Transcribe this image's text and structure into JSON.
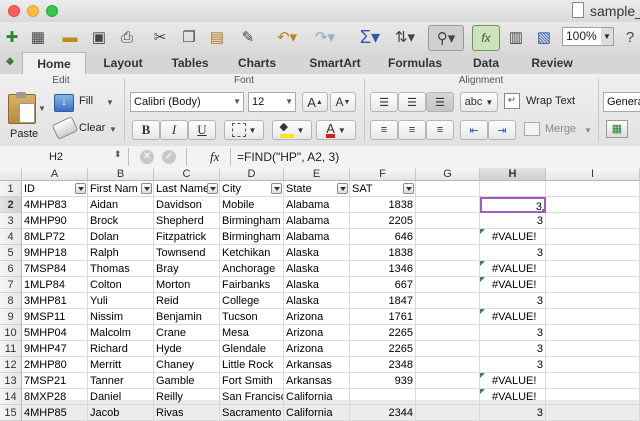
{
  "window": {
    "title": "sample_"
  },
  "toolbar": {
    "zoom": "100%"
  },
  "tabs": [
    "Home",
    "Layout",
    "Tables",
    "Charts",
    "SmartArt",
    "Formulas",
    "Data",
    "Review"
  ],
  "ribbon": {
    "edit_label": "Edit",
    "font_label": "Font",
    "alignment_label": "Alignment",
    "paste_label": "Paste",
    "fill_label": "Fill",
    "clear_label": "Clear",
    "font_name": "Calibri (Body)",
    "font_size": "12",
    "bold": "B",
    "italic": "I",
    "underline": "U",
    "abc_label": "abc",
    "wrap_text_label": "Wrap Text",
    "merge_label": "Merge",
    "number_format": "Genera"
  },
  "formula_bar": {
    "cell_ref": "H2",
    "fx": "fx",
    "formula": "=FIND(\"HP\", A2, 3)"
  },
  "columns": [
    "A",
    "B",
    "C",
    "D",
    "E",
    "F",
    "G",
    "H",
    "I"
  ],
  "header_row": [
    "ID",
    "First Nam",
    "Last Name",
    "City",
    "State",
    "SAT",
    "",
    "",
    ""
  ],
  "rows": [
    [
      "4MHP83",
      "Aidan",
      "Davidson",
      "Mobile",
      "Alabama",
      "1838",
      "",
      "3",
      ""
    ],
    [
      "4MHP90",
      "Brock",
      "Shepherd",
      "Birmingham",
      "Alabama",
      "2205",
      "",
      "3",
      ""
    ],
    [
      "8MLP72",
      "Dolan",
      "Fitzpatrick",
      "Birmingham",
      "Alabama",
      "646",
      "",
      "#VALUE!",
      ""
    ],
    [
      "9MHP18",
      "Ralph",
      "Townsend",
      "Ketchikan",
      "Alaska",
      "1838",
      "",
      "3",
      ""
    ],
    [
      "7MSP84",
      "Thomas",
      "Bray",
      "Anchorage",
      "Alaska",
      "1346",
      "",
      "#VALUE!",
      ""
    ],
    [
      "1MLP84",
      "Colton",
      "Morton",
      "Fairbanks",
      "Alaska",
      "667",
      "",
      "#VALUE!",
      ""
    ],
    [
      "3MHP81",
      "Yuli",
      "Reid",
      "College",
      "Alaska",
      "1847",
      "",
      "3",
      ""
    ],
    [
      "9MSP11",
      "Nissim",
      "Benjamin",
      "Tucson",
      "Arizona",
      "1761",
      "",
      "#VALUE!",
      ""
    ],
    [
      "5MHP04",
      "Malcolm",
      "Crane",
      "Mesa",
      "Arizona",
      "2265",
      "",
      "3",
      ""
    ],
    [
      "9MHP47",
      "Richard",
      "Hyde",
      "Glendale",
      "Arizona",
      "2265",
      "",
      "3",
      ""
    ],
    [
      "2MHP80",
      "Merritt",
      "Chaney",
      "Little Rock",
      "Arkansas",
      "2348",
      "",
      "3",
      ""
    ],
    [
      "7MSP21",
      "Tanner",
      "Gamble",
      "Fort Smith",
      "Arkansas",
      "939",
      "",
      "#VALUE!",
      ""
    ],
    [
      "8MXP28",
      "Daniel",
      "Reilly",
      "San Francisco",
      "California",
      "",
      "",
      "#VALUE!",
      ""
    ],
    [
      "4MHP85",
      "Jacob",
      "Rivas",
      "Sacramento",
      "California",
      "2344",
      "",
      "3",
      ""
    ]
  ]
}
